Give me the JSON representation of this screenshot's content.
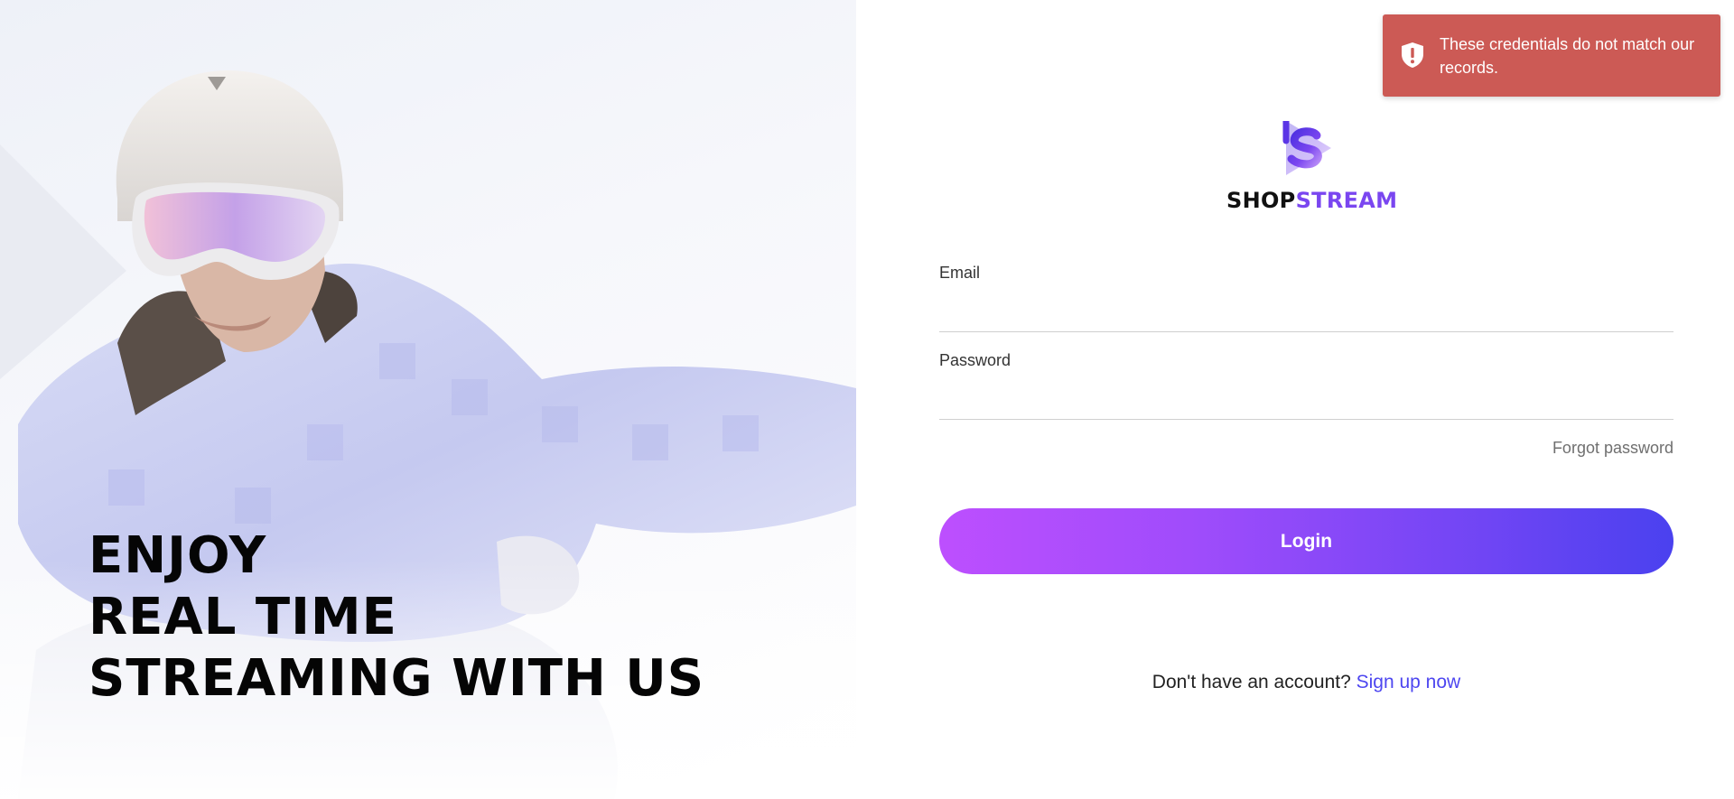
{
  "hero": {
    "headline_lines": [
      "ENJOY",
      "REAL TIME",
      "STREAMING WITH US"
    ]
  },
  "toast": {
    "icon": "shield-exclamation-icon",
    "message": "These credentials do not match our records.",
    "color": "#cc5a55"
  },
  "brand": {
    "logo_icon": "shopstream-logo-icon",
    "name_part1": "SHOP",
    "name_part2": "STREAM",
    "accent_color": "#7a46f0"
  },
  "form": {
    "email_label": "Email",
    "email_value": "",
    "password_label": "Password",
    "password_value": "",
    "forgot_label": "Forgot password",
    "login_label": "Login",
    "signup_prompt": "Don't have an account?",
    "signup_link": "Sign up now",
    "button_gradient": [
      "#bd4ffe",
      "#4a41ef"
    ]
  }
}
